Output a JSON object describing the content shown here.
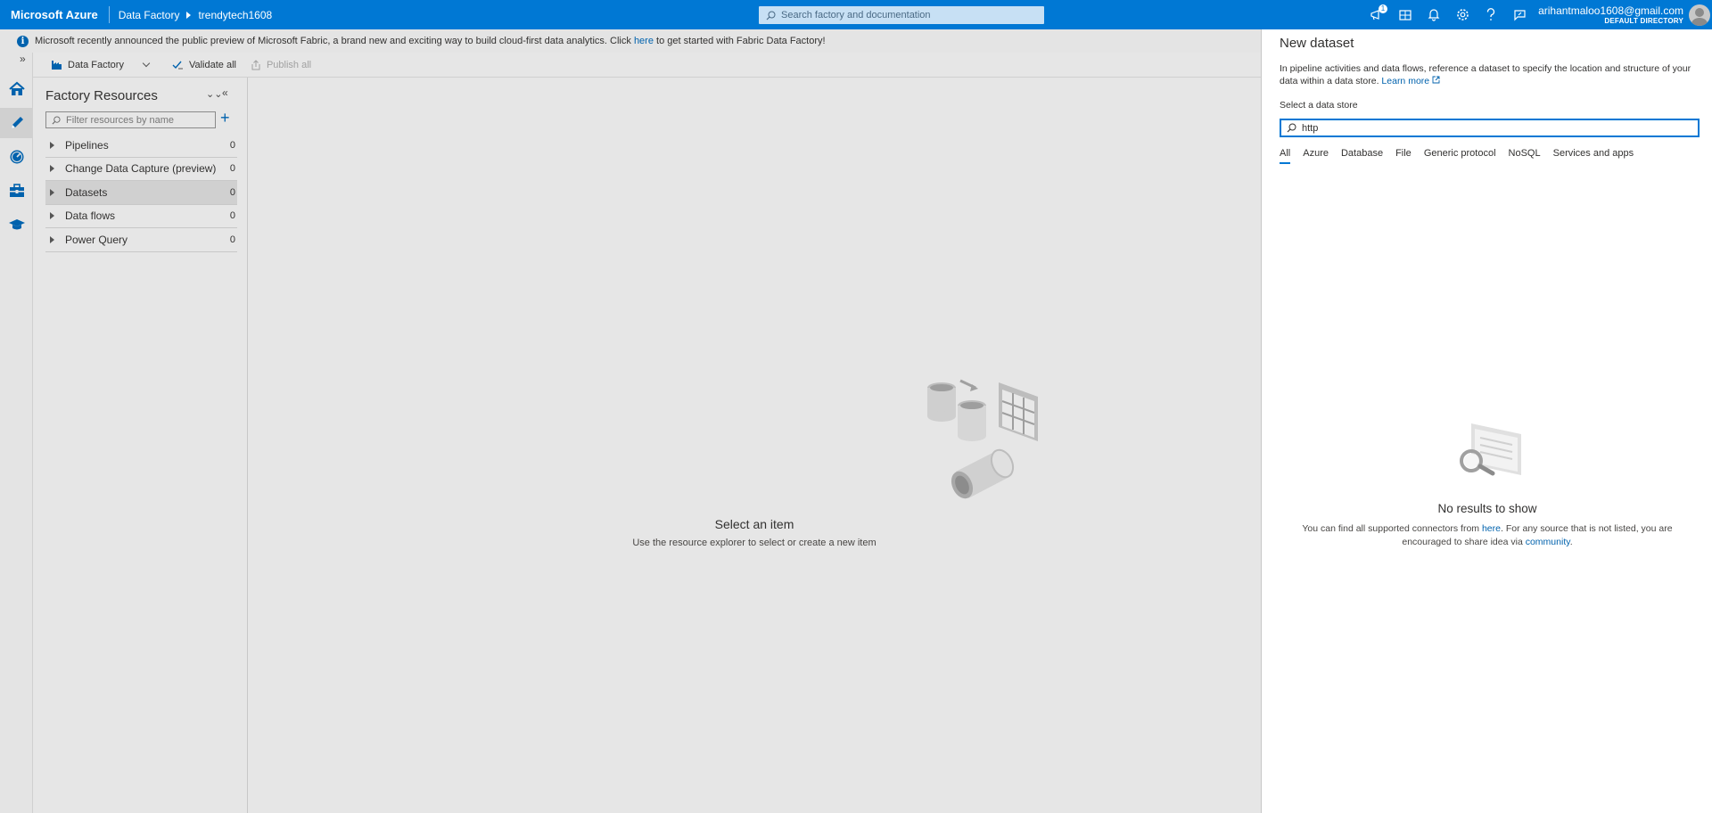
{
  "topbar": {
    "brand": "Microsoft Azure",
    "breadcrumb": [
      "Data Factory",
      "trendytech1608"
    ],
    "search_placeholder": "Search factory and documentation",
    "notification_count": "1",
    "user_email": "arihantmaloo1608@gmail.com",
    "user_directory": "DEFAULT DIRECTORY",
    "accent": "#0078d4"
  },
  "banner": {
    "text_before": "Microsoft recently announced the public preview of Microsoft Fabric, a brand new and exciting way to build cloud-first data analytics. Click ",
    "link": "here",
    "text_after": " to get started with Fabric Data Factory!"
  },
  "rail": {
    "items": [
      "home-icon",
      "author-pencil-icon",
      "monitor-icon",
      "manage-toolbox-icon",
      "learning-hat-icon"
    ]
  },
  "toolbar": {
    "factory_label": "Data Factory",
    "validate_label": "Validate all",
    "publish_label": "Publish all"
  },
  "resources": {
    "title": "Factory Resources",
    "filter_placeholder": "Filter resources by name",
    "items": [
      {
        "label": "Pipelines",
        "count": "0"
      },
      {
        "label": "Change Data Capture (preview)",
        "count": "0"
      },
      {
        "label": "Datasets",
        "count": "0"
      },
      {
        "label": "Data flows",
        "count": "0"
      },
      {
        "label": "Power Query",
        "count": "0"
      }
    ]
  },
  "center": {
    "title": "Select an item",
    "subtitle": "Use the resource explorer to select or create a new item"
  },
  "panel": {
    "title": "New dataset",
    "description": "In pipeline activities and data flows, reference a dataset to specify the location and structure of your data within a data store.",
    "learn_more": "Learn more",
    "select_label": "Select a data store",
    "search_value": "http",
    "tabs": [
      "All",
      "Azure",
      "Database",
      "File",
      "Generic protocol",
      "NoSQL",
      "Services and apps"
    ],
    "empty_title": "No results to show",
    "empty_text_1": "You can find all supported connectors from ",
    "empty_link_1": "here",
    "empty_text_2": ". For any source that is not listed, you are encouraged to share idea via ",
    "empty_link_2": "community",
    "empty_text_3": "."
  }
}
